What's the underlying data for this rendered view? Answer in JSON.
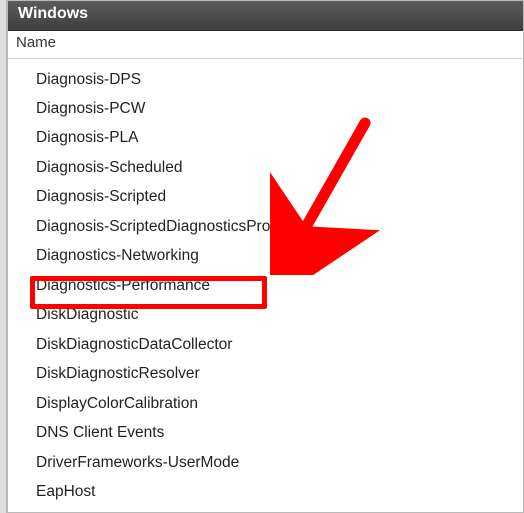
{
  "window": {
    "title": "Windows"
  },
  "columns": {
    "name": "Name"
  },
  "items": [
    {
      "label": "Diagnosis-DPS"
    },
    {
      "label": "Diagnosis-PCW"
    },
    {
      "label": "Diagnosis-PLA"
    },
    {
      "label": "Diagnosis-Scheduled"
    },
    {
      "label": "Diagnosis-Scripted"
    },
    {
      "label": "Diagnosis-ScriptedDiagnosticsProvider"
    },
    {
      "label": "Diagnostics-Networking"
    },
    {
      "label": "Diagnostics-Performance"
    },
    {
      "label": "DiskDiagnostic"
    },
    {
      "label": "DiskDiagnosticDataCollector"
    },
    {
      "label": "DiskDiagnosticResolver"
    },
    {
      "label": "DisplayColorCalibration"
    },
    {
      "label": "DNS Client Events"
    },
    {
      "label": "DriverFrameworks-UserMode"
    },
    {
      "label": "EapHost"
    }
  ],
  "annotation": {
    "highlighted_index": 7,
    "highlight_color": "#ff0000"
  }
}
